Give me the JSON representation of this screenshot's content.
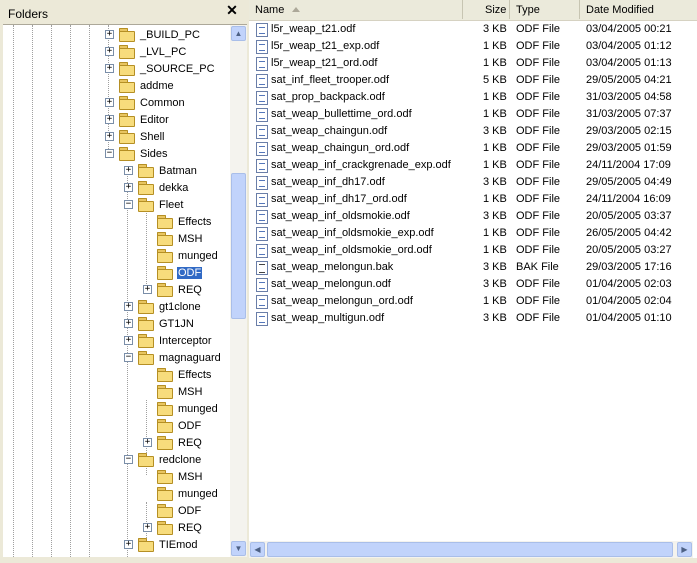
{
  "folders_pane": {
    "title": "Folders",
    "close_glyph": "✕"
  },
  "tree": [
    {
      "label": "_BUILD_PC",
      "toggle": "+"
    },
    {
      "label": "_LVL_PC",
      "toggle": "+"
    },
    {
      "label": "_SOURCE_PC",
      "toggle": "+"
    },
    {
      "label": "addme",
      "toggle": ""
    },
    {
      "label": "Common",
      "toggle": "+"
    },
    {
      "label": "Editor",
      "toggle": "+"
    },
    {
      "label": "Shell",
      "toggle": "+"
    },
    {
      "label": "Sides",
      "toggle": "−"
    },
    {
      "label": "Batman",
      "toggle": "+"
    },
    {
      "label": "dekka",
      "toggle": "+"
    },
    {
      "label": "Fleet",
      "toggle": "−"
    },
    {
      "label": "Effects",
      "toggle": ""
    },
    {
      "label": "MSH",
      "toggle": ""
    },
    {
      "label": "munged",
      "toggle": ""
    },
    {
      "label": "ODF",
      "toggle": "",
      "selected": true
    },
    {
      "label": "REQ",
      "toggle": "+"
    },
    {
      "label": "gt1clone",
      "toggle": "+"
    },
    {
      "label": "GT1JN",
      "toggle": "+"
    },
    {
      "label": "Interceptor",
      "toggle": "+"
    },
    {
      "label": "magnaguard",
      "toggle": "−"
    },
    {
      "label": "Effects",
      "toggle": ""
    },
    {
      "label": "MSH",
      "toggle": ""
    },
    {
      "label": "munged",
      "toggle": ""
    },
    {
      "label": "ODF",
      "toggle": ""
    },
    {
      "label": "REQ",
      "toggle": "+"
    },
    {
      "label": "redclone",
      "toggle": "−"
    },
    {
      "label": "MSH",
      "toggle": ""
    },
    {
      "label": "munged",
      "toggle": ""
    },
    {
      "label": "ODF",
      "toggle": ""
    },
    {
      "label": "REQ",
      "toggle": "+"
    },
    {
      "label": "TIEmod",
      "toggle": "+"
    }
  ],
  "columns": {
    "name": "Name",
    "size": "Size",
    "type": "Type",
    "date": "Date Modified"
  },
  "files": [
    {
      "name": "l5r_weap_t21.odf",
      "size": "3 KB",
      "type": "ODF File",
      "date": "03/04/2005 00:21",
      "icon": "odf-file-icon"
    },
    {
      "name": "l5r_weap_t21_exp.odf",
      "size": "1 KB",
      "type": "ODF File",
      "date": "03/04/2005 01:12",
      "icon": "odf-file-icon"
    },
    {
      "name": "l5r_weap_t21_ord.odf",
      "size": "1 KB",
      "type": "ODF File",
      "date": "03/04/2005 01:13",
      "icon": "odf-file-icon"
    },
    {
      "name": "sat_inf_fleet_trooper.odf",
      "size": "5 KB",
      "type": "ODF File",
      "date": "29/05/2005 04:21",
      "icon": "odf-file-icon"
    },
    {
      "name": "sat_prop_backpack.odf",
      "size": "1 KB",
      "type": "ODF File",
      "date": "31/03/2005 04:58",
      "icon": "odf-file-icon"
    },
    {
      "name": "sat_weap_bullettime_ord.odf",
      "size": "1 KB",
      "type": "ODF File",
      "date": "31/03/2005 07:37",
      "icon": "odf-file-icon"
    },
    {
      "name": "sat_weap_chaingun.odf",
      "size": "3 KB",
      "type": "ODF File",
      "date": "29/03/2005 02:15",
      "icon": "odf-file-icon"
    },
    {
      "name": "sat_weap_chaingun_ord.odf",
      "size": "1 KB",
      "type": "ODF File",
      "date": "29/03/2005 01:59",
      "icon": "odf-file-icon"
    },
    {
      "name": "sat_weap_inf_crackgrenade_exp.odf",
      "size": "1 KB",
      "type": "ODF File",
      "date": "24/11/2004 17:09",
      "icon": "odf-file-icon"
    },
    {
      "name": "sat_weap_inf_dh17.odf",
      "size": "3 KB",
      "type": "ODF File",
      "date": "29/05/2005 04:49",
      "icon": "odf-file-icon"
    },
    {
      "name": "sat_weap_inf_dh17_ord.odf",
      "size": "1 KB",
      "type": "ODF File",
      "date": "24/11/2004 16:09",
      "icon": "odf-file-icon"
    },
    {
      "name": "sat_weap_inf_oldsmokie.odf",
      "size": "3 KB",
      "type": "ODF File",
      "date": "20/05/2005 03:37",
      "icon": "odf-file-icon"
    },
    {
      "name": "sat_weap_inf_oldsmokie_exp.odf",
      "size": "1 KB",
      "type": "ODF File",
      "date": "26/05/2005 04:42",
      "icon": "odf-file-icon"
    },
    {
      "name": "sat_weap_inf_oldsmokie_ord.odf",
      "size": "1 KB",
      "type": "ODF File",
      "date": "20/05/2005 03:27",
      "icon": "odf-file-icon"
    },
    {
      "name": "sat_weap_melongun.bak",
      "size": "3 KB",
      "type": "BAK File",
      "date": "29/03/2005 17:16",
      "icon": "bak-file-icon"
    },
    {
      "name": "sat_weap_melongun.odf",
      "size": "3 KB",
      "type": "ODF File",
      "date": "01/04/2005 02:03",
      "icon": "odf-file-icon"
    },
    {
      "name": "sat_weap_melongun_ord.odf",
      "size": "1 KB",
      "type": "ODF File",
      "date": "01/04/2005 02:04",
      "icon": "odf-file-icon"
    },
    {
      "name": "sat_weap_multigun.odf",
      "size": "3 KB",
      "type": "ODF File",
      "date": "01/04/2005 01:10",
      "icon": "odf-file-icon"
    }
  ],
  "glyphs": {
    "up": "▲",
    "down": "▼",
    "left": "◀",
    "right": "▶"
  }
}
